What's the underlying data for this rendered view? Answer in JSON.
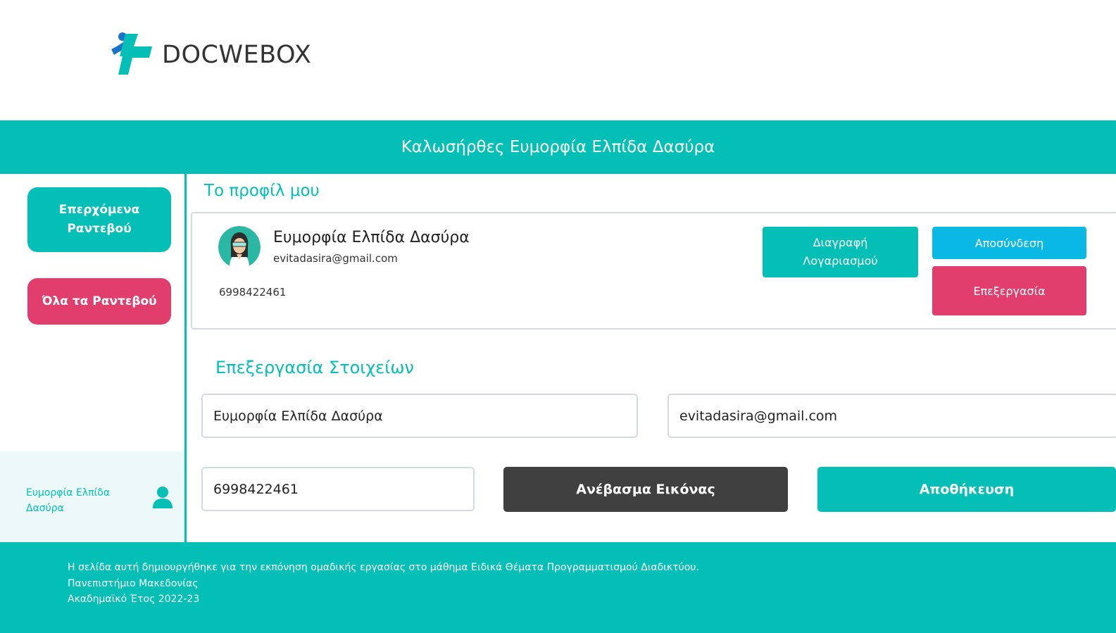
{
  "header": {
    "logo_text": "DOCWEBOX"
  },
  "banner": {
    "welcome": "Καλωσήρθες Ευμορφία Ελπίδα Δασύρα"
  },
  "sidebar": {
    "upcoming_label": "Επερχόμενα Ραντεβού",
    "all_label": "Όλα τα Ραντεβού",
    "user_name": "Ευμορφία Ελπίδα Δασύρα"
  },
  "profile": {
    "title": "Το προφίλ μου",
    "name": "Ευμορφία Ελπίδα Δασύρα",
    "email": "evitadasira@gmail.com",
    "phone": "6998422461",
    "delete_label": "Διαγραφή Λογαριασμού",
    "logout_label": "Αποσύνδεση",
    "edit_label": "Επεξεργασία"
  },
  "edit": {
    "title": "Επεξεργασία Στοιχείων",
    "name_value": "Ευμορφία Ελπίδα Δασύρα",
    "email_value": "evitadasira@gmail.com",
    "phone_value": "6998422461",
    "upload_label": "Ανέβασμα Εικόνας",
    "save_label": "Αποθήκευση"
  },
  "footer": {
    "line1": "Η σελίδα αυτή δημιουργήθηκε για την εκπόνηση ομαδικής εργασίας στο μάθημα Ειδικά Θέματα Προγραμματισμού Διαδικτύου.",
    "line2": "Πανεπιστήμιο Μακεδονίας",
    "line3": "Ακαδημαϊκό Έτος 2022-23"
  },
  "colors": {
    "teal": "#03bfb5",
    "pink": "#e23e6d",
    "blue": "#0ab8e6",
    "dark": "#404040"
  }
}
